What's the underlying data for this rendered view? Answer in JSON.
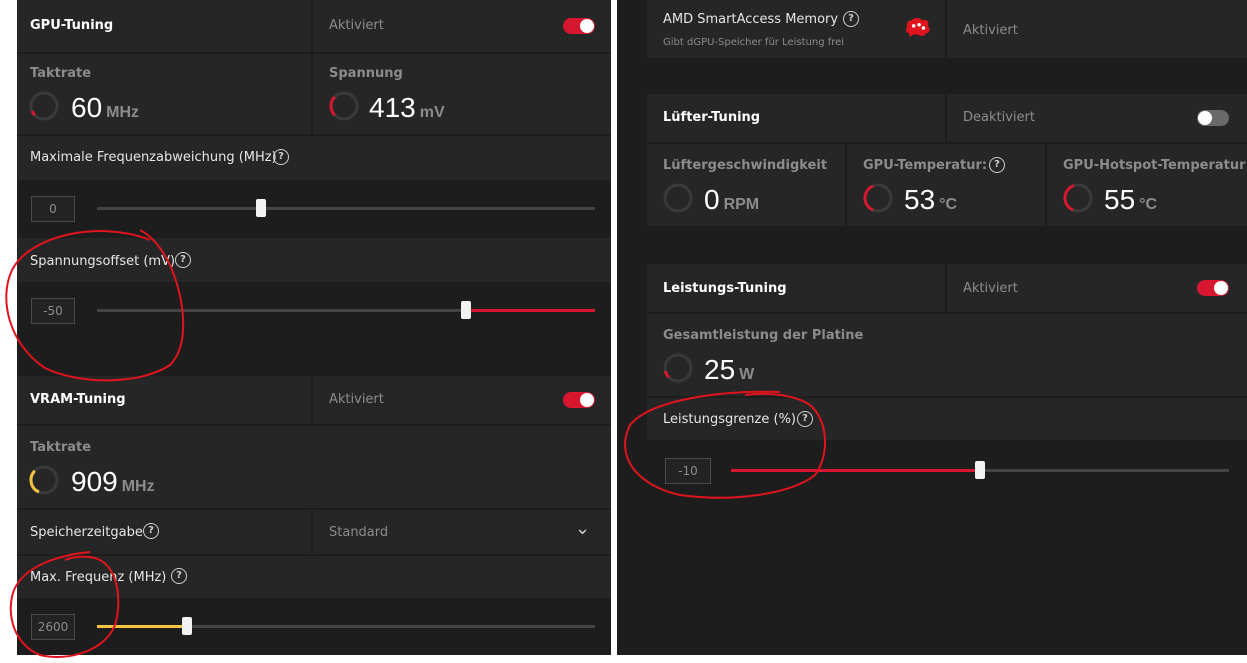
{
  "gpu_tuning": {
    "title": "GPU-Tuning",
    "status": "Aktiviert",
    "enabled": true,
    "clock_label": "Taktrate",
    "clock_value": "60",
    "clock_unit": "MHz",
    "voltage_label": "Spannung",
    "voltage_value": "413",
    "voltage_unit": "mV",
    "max_freq_offset_label": "Maximale Frequenzabweichung (MHz)",
    "max_freq_offset_value": "0",
    "max_freq_offset_level": 0.33,
    "voltage_offset_label": "Spannungsoffset (mV)",
    "voltage_offset_value": "-50",
    "voltage_offset_level": 0.74
  },
  "vram_tuning": {
    "title": "VRAM-Tuning",
    "status": "Aktiviert",
    "enabled": true,
    "clock_label": "Taktrate",
    "clock_value": "909",
    "clock_unit": "MHz",
    "memory_timing_label": "Speicherzeitgabe",
    "memory_timing_value": "Standard",
    "max_freq_label": "Max. Frequenz (MHz)",
    "max_freq_value": "2600",
    "max_freq_level": 0.18
  },
  "sam": {
    "title": "AMD SmartAccess Memory",
    "subtitle": "Gibt dGPU-Speicher für Leistung frei",
    "status": "Aktiviert"
  },
  "fan_tuning": {
    "title": "Lüfter-Tuning",
    "status": "Deaktiviert",
    "enabled": false,
    "fan_speed_label": "Lüftergeschwindigkeit",
    "fan_speed_value": "0",
    "fan_speed_unit": "RPM",
    "gpu_temp_label": "GPU-Temperatur:",
    "gpu_temp_value": "53",
    "gpu_temp_unit": "°C",
    "hotspot_label": "GPU-Hotspot-Temperatur",
    "hotspot_value": "55",
    "hotspot_unit": "°C"
  },
  "power_tuning": {
    "title": "Leistungs-Tuning",
    "status": "Aktiviert",
    "enabled": true,
    "board_power_label": "Gesamtleistung der Platine",
    "board_power_value": "25",
    "board_power_unit": "W",
    "power_limit_label": "Leistungsgrenze (%)",
    "power_limit_value": "-10",
    "power_limit_level": 0.5
  },
  "help_glyph": "?",
  "chevron_glyph": "⌄",
  "colors": {
    "accent_red": "#d6172f",
    "accent_yellow": "#f5c342",
    "panel": "#1d1d1d",
    "cell": "#262626",
    "annotation": "#e0141e"
  }
}
